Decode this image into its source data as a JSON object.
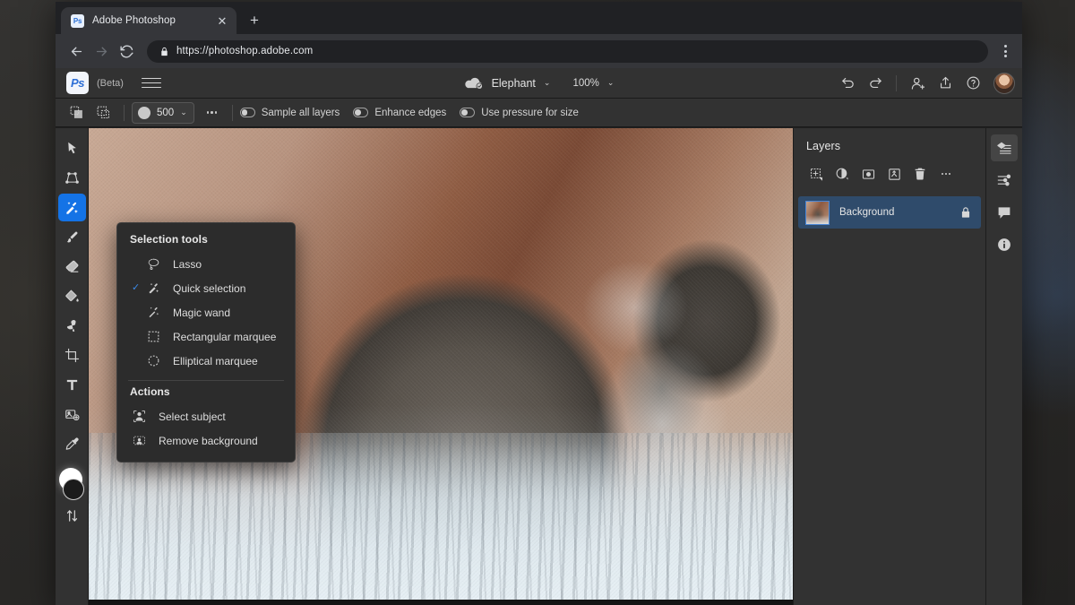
{
  "browser": {
    "tab": {
      "favicon": "ps-favicon",
      "title": "Adobe Photoshop",
      "close_label": "✕"
    },
    "new_tab_label": "+",
    "nav": {
      "back": "back-arrow",
      "forward": "forward-arrow",
      "reload": "reload-arrow"
    },
    "omnibox": {
      "url": "https://photoshop.adobe.com",
      "lock": "lock-icon"
    },
    "menu": "browser-menu"
  },
  "ps_header": {
    "logo_text": "Ps",
    "beta_label": "(Beta)",
    "menu_label": "hamburger-menu",
    "document_name": "Elephant",
    "document_chevron": "⌄",
    "cloud_status": "cloud-saved-icon",
    "zoom_level": "100%",
    "zoom_chevron": "⌄",
    "undo_label": "undo-icon",
    "redo_label": "redo-icon",
    "invite_label": "invite-user-icon",
    "share_label": "share-icon",
    "help_label": "help-icon",
    "avatar_label": "user-avatar"
  },
  "options_bar": {
    "add_to_selection_label": "add-to-selection-icon",
    "subtract_from_selection_label": "subtract-from-selection-icon",
    "brush_size": "500",
    "brush_chevron": "⌄",
    "more_options_label": "more-brush-options",
    "toggles": [
      {
        "label": "Sample all layers",
        "state": "off"
      },
      {
        "label": "Enhance edges",
        "state": "off"
      },
      {
        "label": "Use pressure for size",
        "state": "off"
      }
    ]
  },
  "tools": [
    {
      "name": "move-tool",
      "icon": "cursor-arrow",
      "active": false
    },
    {
      "name": "transform-tool",
      "icon": "transform",
      "active": false
    },
    {
      "name": "quick-selection-tool",
      "icon": "quick-selection-brush",
      "active": true
    },
    {
      "name": "brush-tool",
      "icon": "paintbrush",
      "active": false
    },
    {
      "name": "eraser-tool",
      "icon": "eraser",
      "active": false
    },
    {
      "name": "paint-bucket-tool",
      "icon": "paint-bucket",
      "active": false
    },
    {
      "name": "clone-stamp-tool",
      "icon": "healing-brush",
      "active": false
    },
    {
      "name": "crop-tool",
      "icon": "crop",
      "active": false
    },
    {
      "name": "type-tool",
      "icon": "type-T",
      "active": false
    },
    {
      "name": "place-image-tool",
      "icon": "place-image",
      "active": false
    },
    {
      "name": "eyedropper-tool",
      "icon": "eyedropper",
      "active": false
    },
    {
      "name": "more-tools",
      "icon": "vertical-sliders",
      "active": false
    }
  ],
  "swatches": {
    "foreground": "#ffffff",
    "background": "#1b1b1b"
  },
  "flyout": {
    "section_tools_title": "Selection tools",
    "tools": [
      {
        "label": "Lasso",
        "icon": "lasso-icon",
        "checked": false
      },
      {
        "label": "Quick selection",
        "icon": "quick-selection-icon",
        "checked": true
      },
      {
        "label": "Magic wand",
        "icon": "magic-wand-icon",
        "checked": false
      },
      {
        "label": "Rectangular marquee",
        "icon": "rectangular-marquee-icon",
        "checked": false
      },
      {
        "label": "Elliptical marquee",
        "icon": "elliptical-marquee-icon",
        "checked": false
      }
    ],
    "section_actions_title": "Actions",
    "actions": [
      {
        "label": "Select subject",
        "icon": "select-subject-icon"
      },
      {
        "label": "Remove background",
        "icon": "remove-background-icon"
      }
    ],
    "check_glyph": "✓"
  },
  "layers_panel": {
    "title": "Layers",
    "tools": [
      {
        "name": "add-layer-button",
        "icon": "add-layer-icon"
      },
      {
        "name": "adjustment-layer-button",
        "icon": "half-circle-icon"
      },
      {
        "name": "layer-mask-button",
        "icon": "mask-icon"
      },
      {
        "name": "clipping-mask-button",
        "icon": "clipping-icon"
      },
      {
        "name": "delete-layer-button",
        "icon": "trash-icon"
      },
      {
        "name": "layer-more-button",
        "icon": "ellipsis-icon"
      }
    ],
    "layers": [
      {
        "name": "Background",
        "locked": true,
        "selected": true,
        "lock_icon": "lock-icon"
      }
    ]
  },
  "right_rail": [
    {
      "name": "layers-panel-toggle",
      "icon": "layers-icon",
      "active": true
    },
    {
      "name": "properties-panel-toggle",
      "icon": "sliders-icon",
      "active": false
    },
    {
      "name": "comments-panel-toggle",
      "icon": "comment-icon",
      "active": false
    },
    {
      "name": "info-panel-toggle",
      "icon": "info-icon",
      "active": false
    }
  ],
  "canvas": {
    "document": "Elephant",
    "alt": "Elephant splashing water with its trunk"
  },
  "colors": {
    "accent_blue": "#1473e6",
    "panel_bg": "#323232",
    "app_bg": "#1f1f1f",
    "flyout_bg": "#2c2c2c",
    "layer_selected": "#2f4b6b",
    "browser_chrome": "#35363a"
  }
}
